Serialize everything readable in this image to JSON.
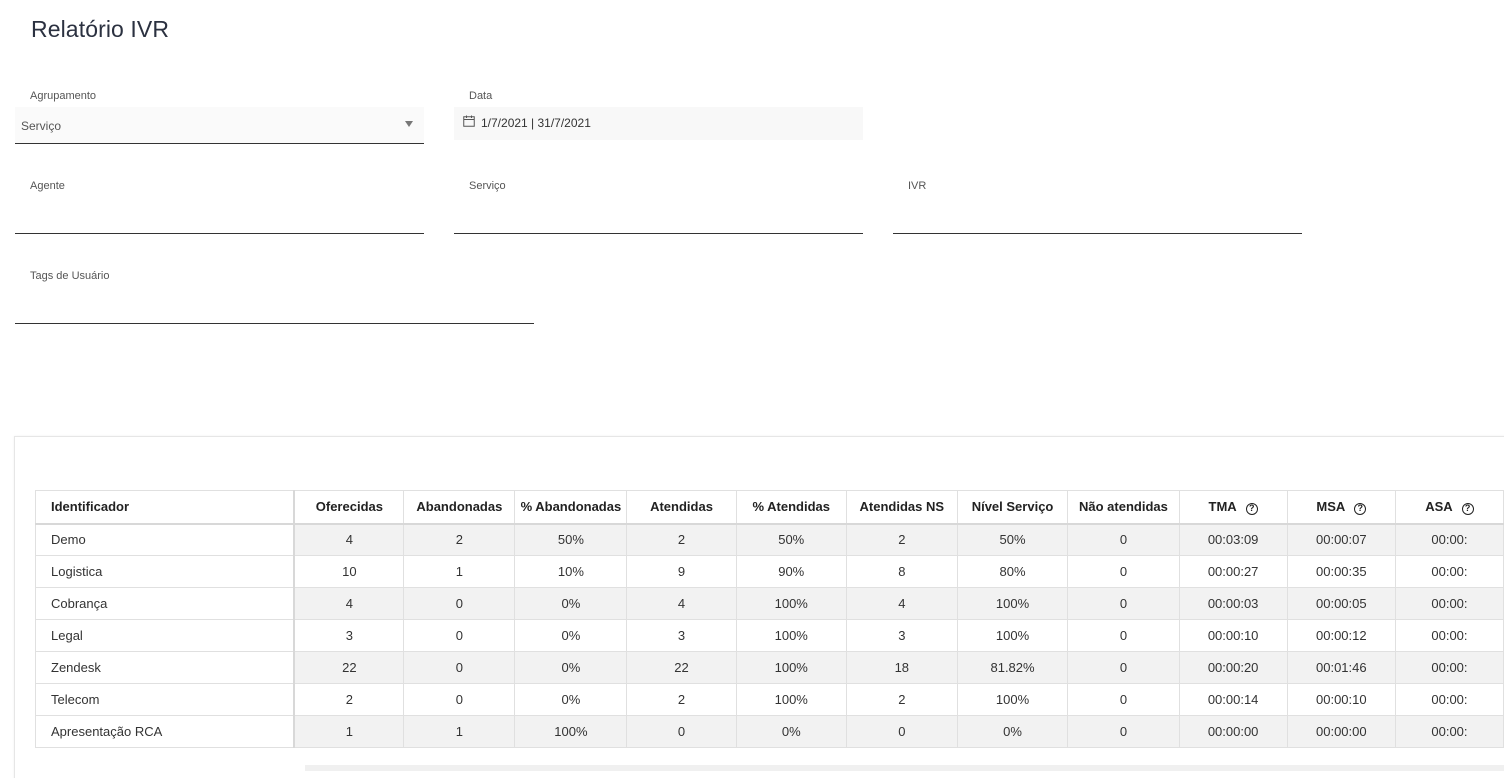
{
  "page": {
    "title": "Relatório IVR"
  },
  "filters": {
    "agrupamento": {
      "label": "Agrupamento",
      "value": "Serviço"
    },
    "data": {
      "label": "Data",
      "value": "1/7/2021 | 31/7/2021"
    },
    "agente": {
      "label": "Agente",
      "value": ""
    },
    "servico": {
      "label": "Serviço",
      "value": ""
    },
    "ivr": {
      "label": "IVR",
      "value": ""
    },
    "tags": {
      "label": "Tags de Usuário",
      "value": ""
    }
  },
  "table": {
    "headers": [
      "Identificador",
      "Oferecidas",
      "Abandonadas",
      "% Abandonadas",
      "Atendidas",
      "% Atendidas",
      "Atendidas NS",
      "Nível Serviço",
      "Não atendidas",
      "TMA",
      "MSA",
      "ASA"
    ],
    "help_icon": "?",
    "rows": [
      [
        "Demo",
        "4",
        "2",
        "50%",
        "2",
        "50%",
        "2",
        "50%",
        "0",
        "00:03:09",
        "00:00:07",
        "00:00:"
      ],
      [
        "Logistica",
        "10",
        "1",
        "10%",
        "9",
        "90%",
        "8",
        "80%",
        "0",
        "00:00:27",
        "00:00:35",
        "00:00:"
      ],
      [
        "Cobrança",
        "4",
        "0",
        "0%",
        "4",
        "100%",
        "4",
        "100%",
        "0",
        "00:00:03",
        "00:00:05",
        "00:00:"
      ],
      [
        "Legal",
        "3",
        "0",
        "0%",
        "3",
        "100%",
        "3",
        "100%",
        "0",
        "00:00:10",
        "00:00:12",
        "00:00:"
      ],
      [
        "Zendesk",
        "22",
        "0",
        "0%",
        "22",
        "100%",
        "18",
        "81.82%",
        "0",
        "00:00:20",
        "00:01:46",
        "00:00:"
      ],
      [
        "Telecom",
        "2",
        "0",
        "0%",
        "2",
        "100%",
        "2",
        "100%",
        "0",
        "00:00:14",
        "00:00:10",
        "00:00:"
      ],
      [
        "Apresentação RCA",
        "1",
        "1",
        "100%",
        "0",
        "0%",
        "0",
        "0%",
        "0",
        "00:00:00",
        "00:00:00",
        "00:00:"
      ]
    ]
  }
}
